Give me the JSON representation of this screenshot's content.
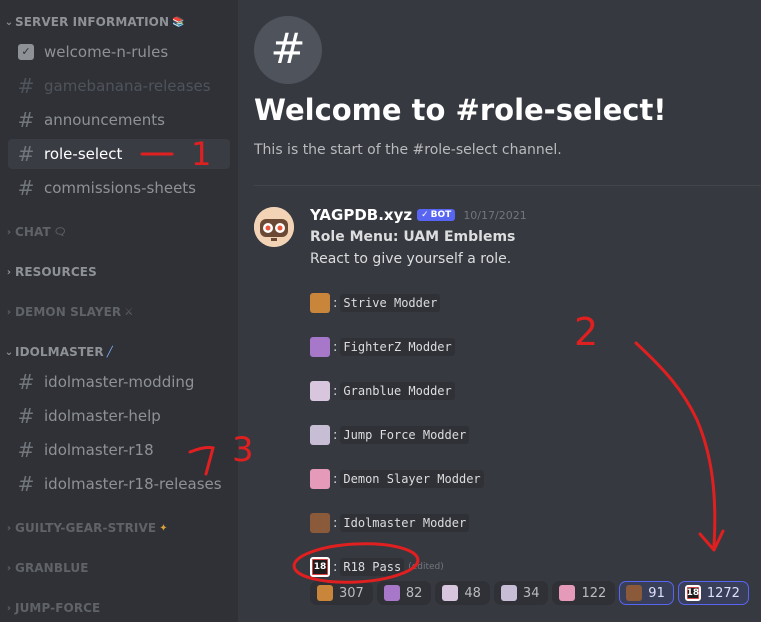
{
  "sidebar": {
    "categories": {
      "server_info": "SERVER INFORMATION",
      "chat": "CHAT",
      "resources": "RESOURCES",
      "demon_slayer": "DEMON SLAYER",
      "idolmaster": "IDOLMASTER",
      "guilty_gear": "GUILTY-GEAR-STRIVE",
      "granblue": "GRANBLUE",
      "jump_force": "JUMP-FORCE"
    },
    "channels": {
      "welcome": "welcome-n-rules",
      "gamebanana": "gamebanana-releases",
      "announcements": "announcements",
      "role_select": "role-select",
      "commissions": "commissions-sheets",
      "idol_modding": "idolmaster-modding",
      "idol_help": "idolmaster-help",
      "idol_r18": "idolmaster-r18",
      "idol_r18_releases": "idolmaster-r18-releases"
    }
  },
  "channel_header": {
    "icon": "#",
    "welcome": "Welcome to #role-select!",
    "start": "This is the start of the #role-select channel."
  },
  "message": {
    "author": "YAGPDB.xyz",
    "bot_tag": "BOT",
    "timestamp": "10/17/2021",
    "title": "Role Menu: UAM Emblems",
    "subtitle": "React to give yourself a role.",
    "separator": ":",
    "roles": [
      "Strive Modder",
      "FighterZ Modder",
      "Granblue Modder",
      "Jump Force Modder",
      "Demon Slayer Modder",
      "Idolmaster Modder",
      "R18 Pass"
    ],
    "edited": "(edited)",
    "r18_emoji_text": "18"
  },
  "reactions": [
    {
      "count": "307",
      "color": "#c9853a",
      "selected": false
    },
    {
      "count": "82",
      "color": "#a778c9",
      "selected": false
    },
    {
      "count": "48",
      "color": "#d7c6dd",
      "selected": false
    },
    {
      "count": "34",
      "color": "#c7bed6",
      "selected": false
    },
    {
      "count": "122",
      "color": "#e49ab8",
      "selected": false
    },
    {
      "count": "91",
      "color": "#8a5a3a",
      "selected": true
    },
    {
      "count": "1272",
      "color": "#1e1e1e",
      "selected": true
    }
  ],
  "annotations": {
    "mark1": "1",
    "mark2": "2",
    "mark3": "3",
    "color": "#e02020"
  }
}
